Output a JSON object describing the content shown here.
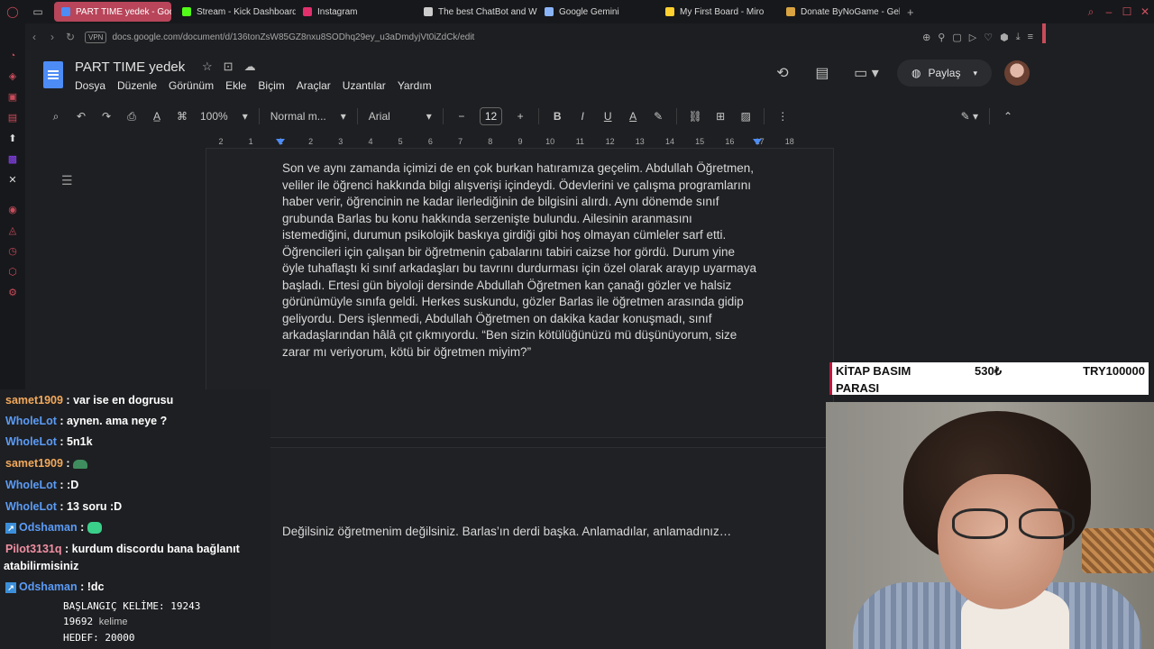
{
  "browser": {
    "tabs": [
      {
        "label": "PART TIME yedek - Goog",
        "color": "#4d8cf5",
        "active": true
      },
      {
        "label": "Stream - Kick Dashboard",
        "color": "#53fc18"
      },
      {
        "label": "Instagram",
        "color": "#e1306c"
      },
      {
        "label": "The best ChatBot and W",
        "color": "#cccccc"
      },
      {
        "label": "Google Gemini",
        "color": "#8ab4f8"
      },
      {
        "label": "My First Board - Miro",
        "color": "#ffd02f"
      },
      {
        "label": "Donate ByNoGame - Gele",
        "color": "#d9a441"
      }
    ],
    "url": "docs.google.com/document/d/136tonZsW85GZ8nxu8SODhq29ey_u3aDmdyjVt0iZdCk/edit",
    "vpn_label": "VPN"
  },
  "docs": {
    "title": "PART TIME  yedek",
    "menu": [
      "Dosya",
      "Düzenle",
      "Görünüm",
      "Ekle",
      "Biçim",
      "Araçlar",
      "Uzantılar",
      "Yardım"
    ],
    "share_label": "Paylaş",
    "toolbar": {
      "zoom": "100%",
      "style": "Normal m...",
      "font": "Arial",
      "font_size": "12",
      "bold": "B",
      "italic": "I",
      "underline": "U",
      "text_color": "A"
    },
    "ruler": [
      "2",
      "1",
      "1",
      "2",
      "3",
      "4",
      "5",
      "6",
      "7",
      "8",
      "9",
      "10",
      "11",
      "12",
      "13",
      "14",
      "15",
      "16",
      "17",
      "18"
    ],
    "page1_text": "Son ve aynı zamanda içimizi de en çok burkan hatıramıza geçelim. Abdullah Öğretmen, veliler ile öğrenci hakkında bilgi alışverişi içindeydi. Ödevlerini ve çalışma programlarını haber verir, öğrencinin ne kadar ilerlediğinin de bilgisini alırdı. Aynı dönemde sınıf grubunda Barlas bu konu hakkında serzenişte bulundu. Ailesinin aranmasını istemediğini, durumun psikolojik baskıya girdiği gibi hoş olmayan cümleler sarf etti. Öğrencileri için çalışan bir öğretmenin çabalarını tabiri caizse hor gördü. Durum yine öyle tuhaflaştı ki sınıf arkadaşları bu tavrını durdurması için özel olarak arayıp uyarmaya başladı. Ertesi gün biyoloji dersinde Abdullah Öğretmen kan çanağı gözler ve halsiz görünümüyle sınıfa geldi. Herkes suskundu, gözler Barlas ile öğretmen arasında gidip geliyordu. Ders işlenmedi, Abdullah Öğretmen on dakika kadar konuşmadı, sınıf arkadaşlarından hâlâ çıt çıkmıyordu. “Ben sizin kötülüğünüzü mü düşünüyorum, size zarar mı veriyorum, kötü bir öğretmen miyim?”",
    "page2_text": "Değilsiniz öğretmenim değilsiniz. Barlas’ın derdi başka. Anlamadılar, anlamadınız…"
  },
  "chat": [
    {
      "user": "samet1909",
      "msg": "var ise en dogrusu",
      "style": "orange"
    },
    {
      "user": "WholeLot",
      "msg": "aynen. ama neye ?",
      "style": "blue"
    },
    {
      "user": "WholeLot",
      "msg": "5n1k",
      "style": "blue"
    },
    {
      "user": "samet1909",
      "msg": "",
      "style": "orange",
      "emote": "hat"
    },
    {
      "user": "WholeLot",
      "msg": ":D",
      "style": "blue"
    },
    {
      "user": "WholeLot",
      "msg": "13 soru :D",
      "style": "blue"
    },
    {
      "user": "Odshaman",
      "msg": "",
      "style": "blue",
      "emote": "cat",
      "badge": true
    },
    {
      "user": "Pilot3131q",
      "msg": "kurdum discordu bana bağlanıt",
      "style": "pink"
    },
    {
      "user": "",
      "msg": "atabilirmisiniz",
      "style": "plain"
    },
    {
      "user": "Odshaman",
      "msg": "!dc",
      "style": "blue",
      "badge": true
    }
  ],
  "counter": {
    "start": "BAŞLANGIÇ KELİME: 19243",
    "current": "19692",
    "current_unit": "kelime",
    "goal": "HEDEF: 20000"
  },
  "overlay": {
    "label1": "KİTAP BASIM",
    "label2": "PARASI",
    "amount": "530₺",
    "goal": "TRY100000"
  }
}
